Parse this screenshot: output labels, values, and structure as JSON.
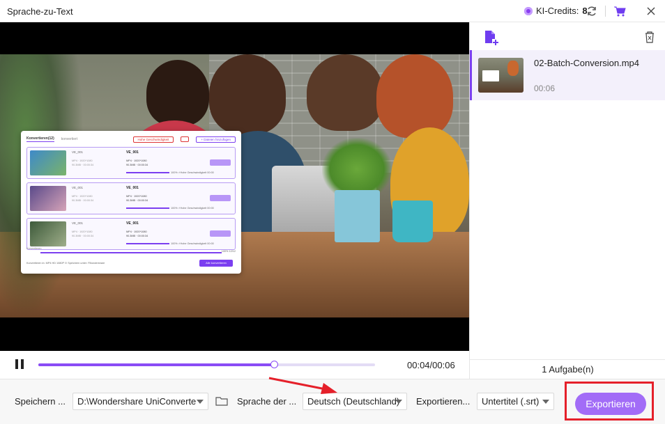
{
  "titlebar": {
    "title": "Sprache-zu-Text",
    "credits_label": "KI-Credits:",
    "credits_value": "8",
    "icons": [
      "coin-icon",
      "refresh-icon",
      "cart-icon",
      "close-icon"
    ]
  },
  "video": {
    "overlay_card": {
      "tab_active": "Konvertieren(12)",
      "tab_other": "konvertiert",
      "speed_chip": "Hohe Geschwindigkeit",
      "add_files": "+ Dateien hinzufügen",
      "rows": [
        {
          "name": "VE_001",
          "title": "VE_001",
          "format": "MP4",
          "resolution": "1920*1080",
          "size": "90.3MB",
          "duration": "00:00:34",
          "progress": "100%",
          "status": "Hohe Geschwindigkeit",
          "extra": "00:00"
        },
        {
          "name": "VE_001",
          "title": "VE_001",
          "format": "MP4",
          "resolution": "1920*1080",
          "size": "90.3MB",
          "duration": "00:00:34",
          "progress": "100%",
          "status": "Hohe Geschwindigkeit",
          "extra": "00:00"
        },
        {
          "name": "VE_001",
          "title": "VE_001",
          "format": "MP4",
          "resolution": "1920*1080",
          "size": "90.3MB",
          "duration": "00:00:34",
          "progress": "100%",
          "status": "Hohe Geschwindigkeit",
          "extra": "00:00"
        }
      ],
      "footer_label": "Konvertieren",
      "footer_progress": "100%",
      "footer_count": "12/12",
      "convert_in_label": "Konvertieren in:",
      "convert_in_value": "MP4 HD 1080P",
      "save_label": "Speichern unter:",
      "save_value": "Fillondershare",
      "convert_all": "Alle konvertieren"
    },
    "current_time": "00:04",
    "total_time": "00:06",
    "time_display": "00:04/00:06",
    "progress_fraction": 0.7
  },
  "panel": {
    "file_name": "02-Batch-Conversion.mp4",
    "file_duration": "00:06",
    "tasks_label": "1 Aufgabe(n)"
  },
  "bottom": {
    "save_label": "Speichern ...",
    "save_path": "D:\\Wondershare UniConverte",
    "language_label": "Sprache der ...",
    "language_value": "Deutsch (Deutschland)",
    "export_label": "Exportieren...",
    "export_format": "Untertitel (.srt)",
    "export_button": "Exportieren"
  },
  "colors": {
    "accent": "#8a4cf5",
    "export_button": "#a26cf7",
    "highlight_box": "#e5202a"
  }
}
